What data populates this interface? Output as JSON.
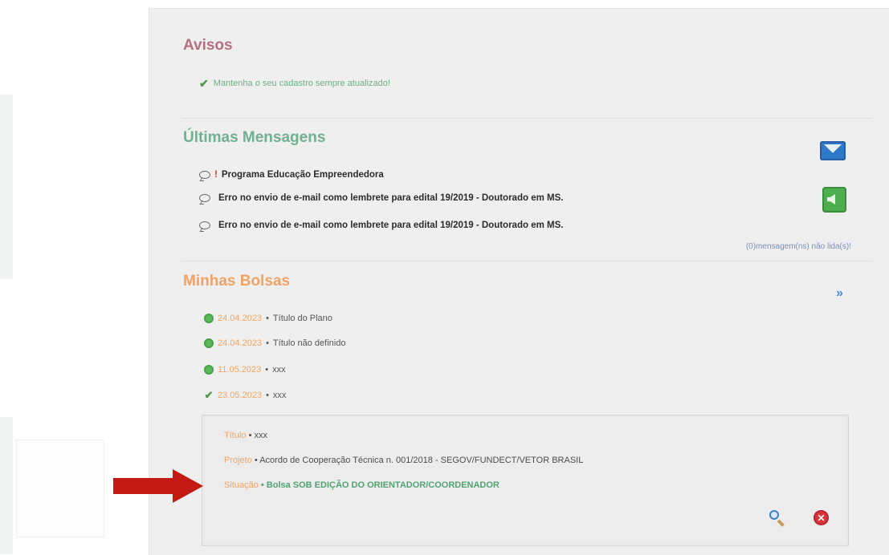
{
  "avisos": {
    "title": "Avisos",
    "items": [
      "Mantenha o seu cadastro sempre atualizado!"
    ]
  },
  "mensagens": {
    "title": "Últimas Mensagens",
    "items": [
      {
        "important": "!",
        "text": "Programa Educação Empreendedora"
      },
      {
        "important": "",
        "text": "Erro no envio de e-mail como lembrete para edital 19/2019 - Doutorado em MS."
      },
      {
        "important": "",
        "text": "Erro no envio de e-mail como lembrete para edital 19/2019 - Doutorado em MS."
      }
    ],
    "unread_link": "(0)mensagem(ns) não lida(s)!"
  },
  "bolsas": {
    "title": "Minhas Bolsas",
    "more_icon": "»",
    "items": [
      {
        "date": "24.04.2023",
        "sep": "•",
        "text": "Título do Plano"
      },
      {
        "date": "24.04.2023",
        "sep": "•",
        "text": "Título não definido"
      },
      {
        "date": "11.05.2023",
        "sep": "•",
        "text": "xxx"
      },
      {
        "date": "23.05.2023",
        "sep": "•",
        "text": "xxx"
      }
    ],
    "detail": {
      "titulo_label": "Título",
      "titulo_value": "• xxx",
      "projeto_label": "Projeto",
      "projeto_value": "• Acordo de Cooperação Técnica n. 001/2018 - SEGOV/FUNDECT/VETOR BRASIL",
      "situacao_label": "Situação",
      "situacao_value": "• Bolsa SOB EDIÇÃO DO ORIENTADOR/COORDENADOR"
    }
  },
  "icons": {
    "check": "✔",
    "delete": "✕"
  },
  "colors": {
    "avisos_title": "#b66e80",
    "mensagens_title": "#6fb192",
    "bolsas_title": "#f0a366",
    "status_green": "#52a372",
    "arrow_red": "#c41a14"
  }
}
